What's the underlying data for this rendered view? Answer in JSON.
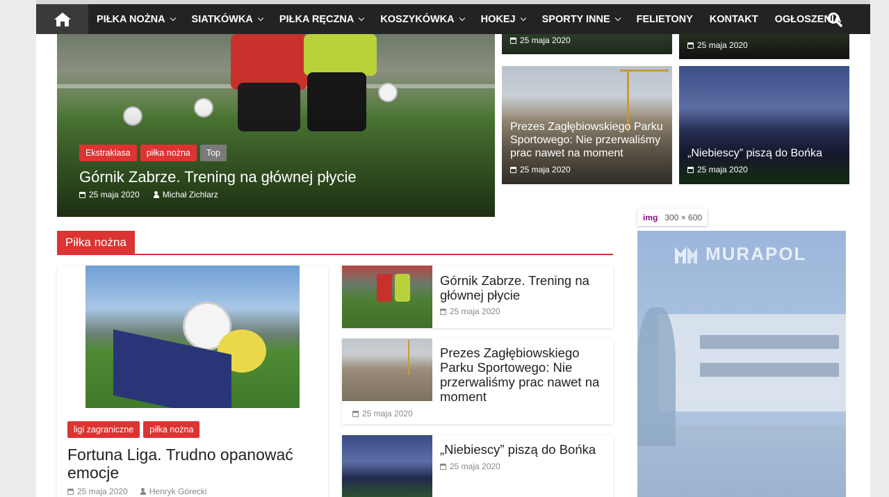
{
  "nav": {
    "items": [
      {
        "label": "PIŁKA NOŻNA",
        "dropdown": true
      },
      {
        "label": "SIATKÓWKA",
        "dropdown": true
      },
      {
        "label": "PIŁKA RĘCZNA",
        "dropdown": true
      },
      {
        "label": "KOSZYKÓWKA",
        "dropdown": true
      },
      {
        "label": "HOKEJ",
        "dropdown": true
      },
      {
        "label": "SPORTY INNE",
        "dropdown": true
      },
      {
        "label": "FELIETONY",
        "dropdown": false
      },
      {
        "label": "KONTAKT",
        "dropdown": false
      },
      {
        "label": "OGŁOSZENIA",
        "dropdown": false
      }
    ]
  },
  "hero": {
    "tags": [
      "Ekstraklasa",
      "piłka nożna",
      "Top"
    ],
    "title": "Górnik Zabrze. Trening na głównej płycie",
    "date": "25 maja 2020",
    "author": "Michał Zichlarz"
  },
  "top_thumbs": [
    {
      "date": "25 maja 2020"
    },
    {
      "date": "25 maja 2020"
    }
  ],
  "thumbs": [
    {
      "title": "Prezes Zagłębiowskiego Parku Sportowego: Nie przerwaliśmy prac nawet na moment",
      "date": "25 maja 2020"
    },
    {
      "title": "„Niebiescy” piszą do Bońka",
      "date": "25 maja 2020"
    }
  ],
  "section": {
    "label": "Piłka nożna"
  },
  "featured": {
    "tags": [
      "ligi zagraniczne",
      "piłka nożna"
    ],
    "title": "Fortuna Liga. Trudno opanować emocje",
    "date": "25 maja 2020",
    "author": "Henryk Górecki"
  },
  "list": [
    {
      "title": "Górnik Zabrze. Trening na głównej płycie",
      "date": "25 maja 2020"
    },
    {
      "title": "Prezes Zagłębiowskiego Parku Sportowego: Nie przerwaliśmy prac nawet na moment",
      "date": "25 maja 2020"
    },
    {
      "title": "„Niebiescy” piszą do Bońka",
      "date": "25 maja 2020"
    }
  ],
  "ad": {
    "tooltip_tag": "img",
    "tooltip_size": "300 × 600",
    "brand": "MURAPOL"
  },
  "colors": {
    "accent": "#dd3333",
    "nav_bg": "#232323"
  }
}
